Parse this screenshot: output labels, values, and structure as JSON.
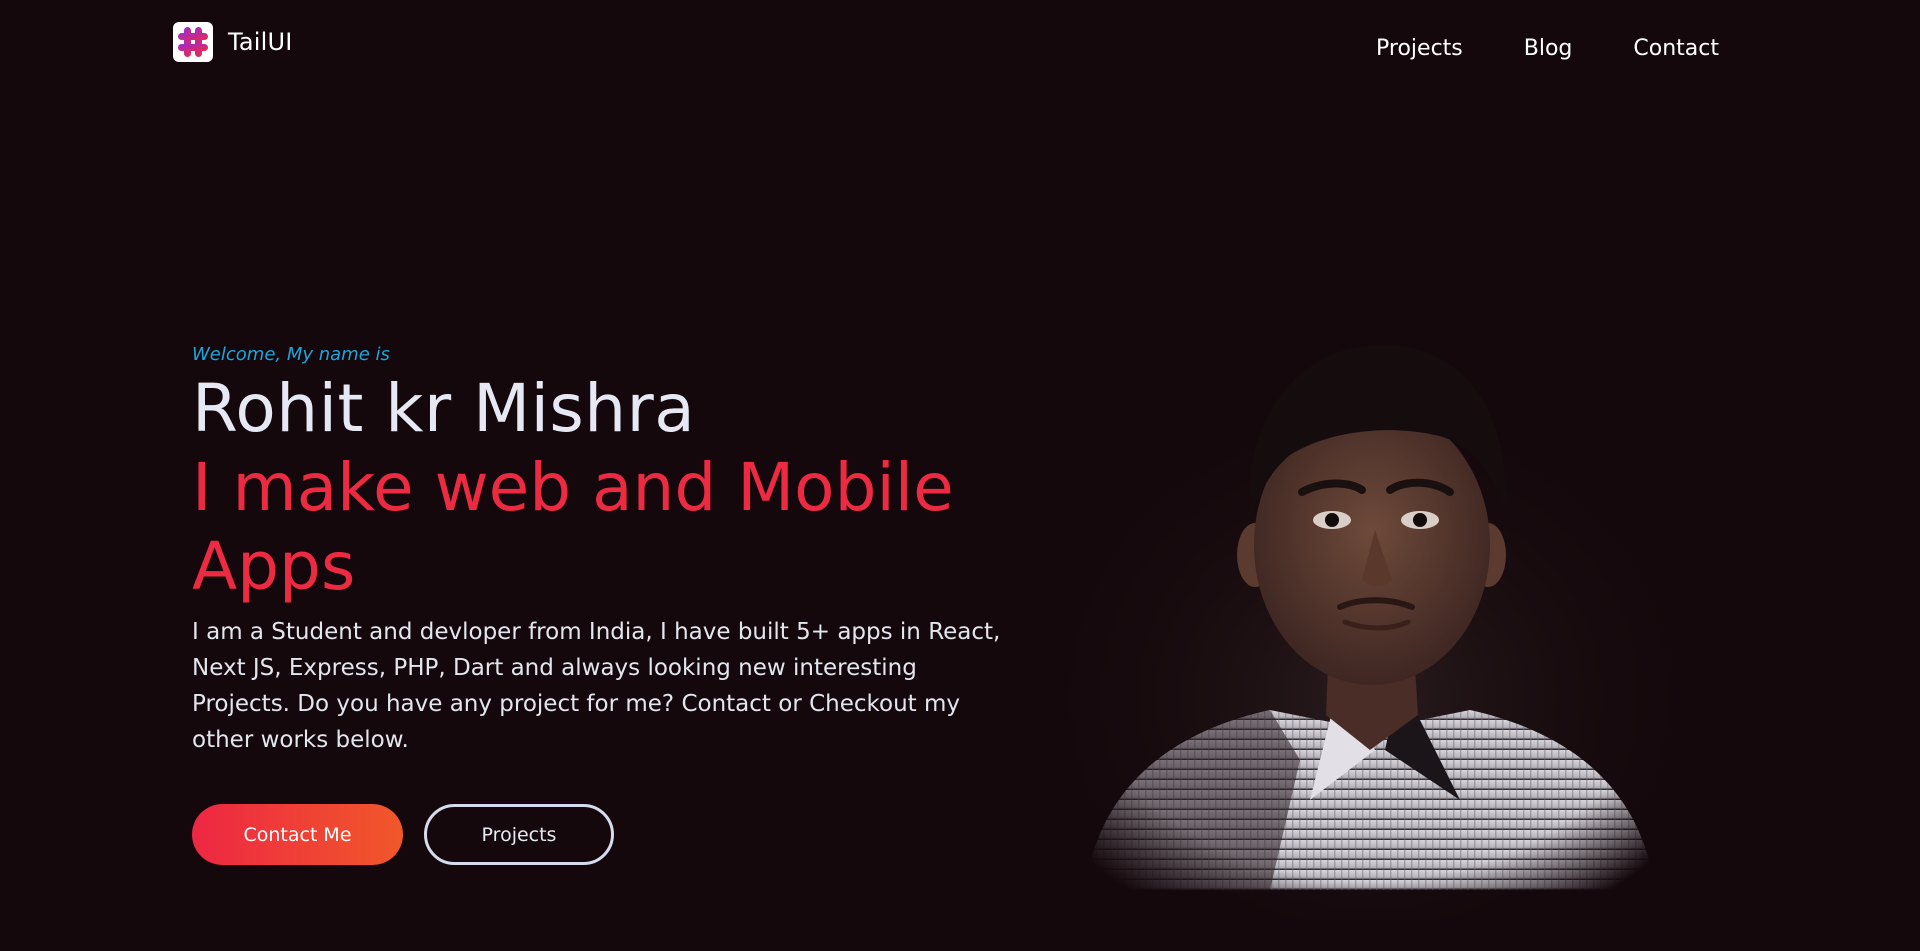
{
  "header": {
    "brand": "TailUI",
    "logo_icon": "hashtag-logo-icon",
    "nav": [
      "Projects",
      "Blog",
      "Contact"
    ]
  },
  "hero": {
    "welcome": "Welcome, My name is",
    "name": "Rohit kr Mishra",
    "tagline": "I make web and Mobile Apps",
    "bio": "I am a Student and devloper from India, I have built 5+ apps in React, Next JS, Express, PHP, Dart and always looking new interesting Projects. Do you have any project for me? Contact or Checkout my other works below.",
    "primary_button": "Contact Me",
    "secondary_button": "Projects",
    "portrait": "portrait-photo"
  },
  "colors": {
    "background": "#14080c",
    "accent": "#ec2a42",
    "welcome": "#1ba6dc",
    "button_gradient_start": "#ee2743",
    "button_gradient_end": "#f0582a"
  }
}
